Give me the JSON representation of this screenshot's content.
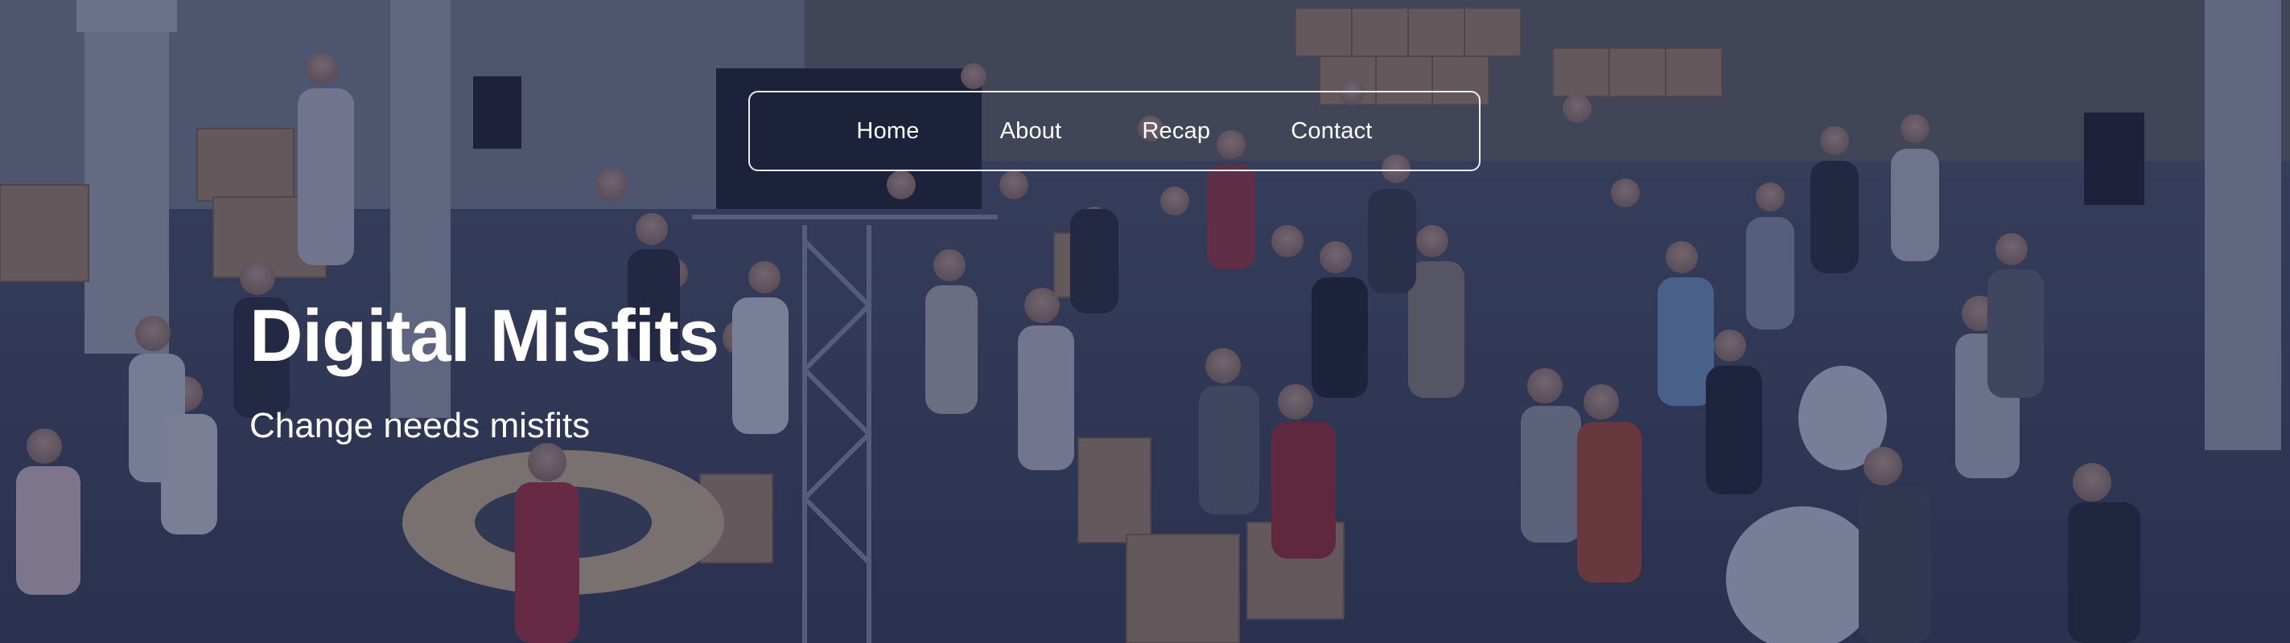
{
  "nav": {
    "items": [
      {
        "label": "Home"
      },
      {
        "label": "About"
      },
      {
        "label": "Recap"
      },
      {
        "label": "Contact"
      }
    ]
  },
  "hero": {
    "title": "Digital Misfits",
    "subtitle": "Change needs misfits"
  },
  "colors": {
    "overlay": "#1e264e",
    "text": "#ffffff",
    "accent_red": "#c0392b"
  }
}
